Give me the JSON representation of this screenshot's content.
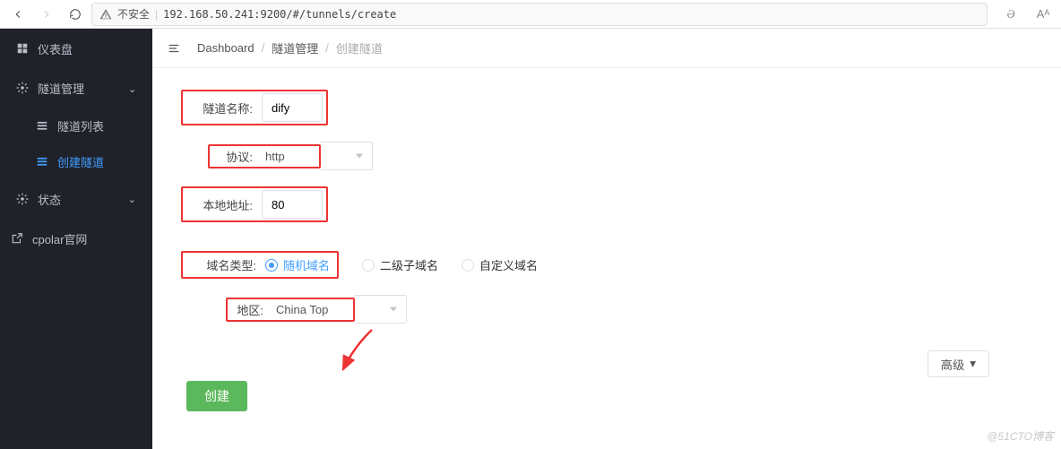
{
  "browser": {
    "insecure_label": "不安全",
    "url": "192.168.50.241:9200/#/tunnels/create",
    "reader_icon": "Ə",
    "font_icon": "Aᴬ"
  },
  "sidebar": {
    "items": [
      {
        "icon": "dashboard",
        "label": "仪表盘"
      },
      {
        "icon": "cog",
        "label": "隧道管理",
        "expanded": true
      },
      {
        "icon": "list",
        "label": "隧道列表",
        "sub": true
      },
      {
        "icon": "list",
        "label": "创建隧道",
        "sub": true,
        "active": true
      },
      {
        "icon": "cog",
        "label": "状态"
      },
      {
        "icon": "ext",
        "label": "cpolar官网"
      }
    ]
  },
  "breadcrumb": {
    "items": [
      "Dashboard",
      "隧道管理",
      "创建隧道"
    ]
  },
  "form": {
    "name_label": "隧道名称:",
    "name_value": "dify",
    "proto_label": "协议:",
    "proto_value": "http",
    "addr_label": "本地地址:",
    "addr_value": "80",
    "domain_label": "域名类型:",
    "domain_options": [
      "随机域名",
      "二级子域名",
      "自定义域名"
    ],
    "domain_selected": 0,
    "region_label": "地区:",
    "region_value": "China Top",
    "advanced_label": "高级",
    "create_label": "创建"
  },
  "watermark": "@51CTO博客"
}
